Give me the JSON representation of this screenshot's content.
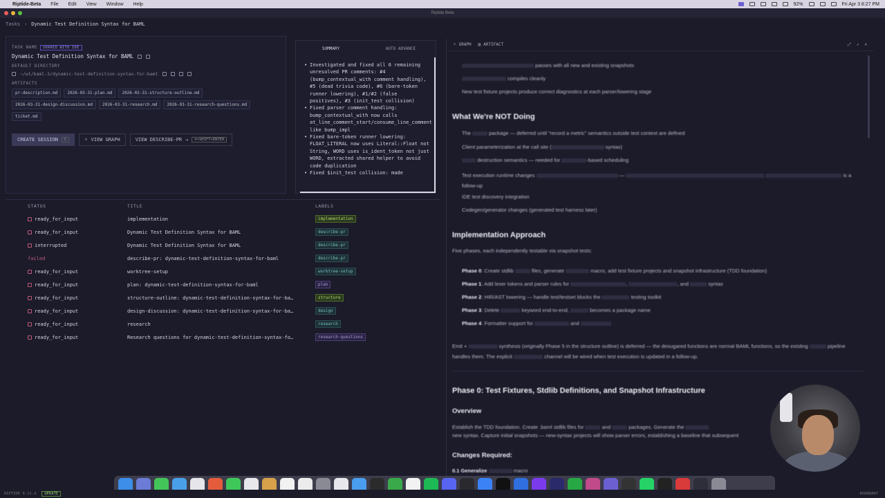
{
  "menubar": {
    "app": "Riptide-Beta",
    "items": [
      "File",
      "Edit",
      "View",
      "Window",
      "Help"
    ],
    "battery": "92%",
    "clock": "Fri Apr 3  8:27 PM"
  },
  "window": {
    "title": "Riptide Beta"
  },
  "breadcrumb": {
    "root": "Tasks",
    "current": "Dynamic Test Definition Syntax for BAML"
  },
  "session": {
    "task_name_label": "TASK NAME",
    "shared_badge": "SHARED WITH IDE",
    "task_name": "Dynamic Test Definition Syntax for BAML",
    "dir_label": "DEFAULT DIRECTORY",
    "dir": "~/wt/baml-3/dynamic-test-definition-syntax-for-baml",
    "artifacts_label": "ARTIFACTS",
    "artifacts": [
      "pr-description.md",
      "2026-03-31-plan.md",
      "2026-03-31-structure-outline.md",
      "2026-03-31-design-discussion.md",
      "2026-03-31-research.md",
      "2026-03-31-research-questions.md",
      "ticket.md"
    ],
    "create_session": "CREATE SESSION",
    "create_session_key": "C",
    "view_graph": "VIEW GRAPH",
    "view_describe": "VIEW DESCRIBE-PR",
    "view_describe_key": "⌘+SHIFT+ENTER"
  },
  "summary": {
    "tab_summary": "SUMMARY",
    "tab_auto": "AUTO ADVANCE",
    "bullets": [
      "Investigated and fixed all 6 remaining unresolved PR comments: #4 (bump_contextual_with comment handling), #5 (dead trivia code), #6 (bare-token runner lowering), #1/#2 (false positives), #3 (init_test collision)",
      "Fixed parser comment handling: bump_contextual_with now calls at_line_comment_start/consume_line_comment like bump_impl",
      "Fixed bare-token runner lowering: FLOAT_LITERAL now uses Literal::Float not String, WORD uses is_ident_token not just WORD, extracted shared helper to avoid code duplication",
      "Fixed $init_test collision: made"
    ]
  },
  "tasks": {
    "headers": {
      "status": "STATUS",
      "title": "TITLE",
      "labels": "LABELS"
    },
    "rows": [
      {
        "status": "ready_for_input",
        "title": "implementation",
        "label": "implementation"
      },
      {
        "status": "ready_for_input",
        "title": "Dynamic Test Definition Syntax for BAML",
        "label": "describe-pr"
      },
      {
        "status": "interrupted",
        "title": "Dynamic Test Definition Syntax for BAML",
        "label": "describe-pr"
      },
      {
        "status": "failed",
        "title": "describe-pr: dynamic-test-definition-syntax-for-baml",
        "label": "describe-pr"
      },
      {
        "status": "ready_for_input",
        "title": "worktree-setup",
        "label": "worktree-setup"
      },
      {
        "status": "ready_for_input",
        "title": "plan: dynamic-test-definition-syntax-for-baml",
        "label": "plan"
      },
      {
        "status": "ready_for_input",
        "title": "structure-outline: dynamic-test-definition-syntax-for-ba…",
        "label": "structure"
      },
      {
        "status": "ready_for_input",
        "title": "design-discussion: dynamic-test-definition-syntax-for-ba…",
        "label": "design"
      },
      {
        "status": "ready_for_input",
        "title": "research",
        "label": "research"
      },
      {
        "status": "ready_for_input",
        "title": "Research questions for dynamic-test-definition-syntax-fo…",
        "label": "research-questions"
      }
    ]
  },
  "artifact": {
    "tab_graph": "GRAPH",
    "tab_artifact": "ARTIFACT",
    "line1": "passes with all new and existing snapshots",
    "line2": "compiles cleanly",
    "line3": "New test fixture projects produce correct diagnostics at each parser/lowering stage",
    "h_not_doing": "What We're NOT Doing",
    "not1a": "The",
    "not1b": "package — deferred until \"record a metric\" semantics outside test context are defined",
    "not2": "Client parameterization at the call site (",
    "not2b": "syntax)",
    "not3": "destruction semantics — needed for",
    "not3b": "-based scheduling",
    "not4": "Test execution runtime changes",
    "not4b": "is a follow-up",
    "not5": "IDE test discovery integration",
    "not6": "Codegen/generator changes (generated test harness later)",
    "h_impl": "Implementation Approach",
    "impl_intro": "Five phases, each independently testable via snapshot tests:",
    "phase0_label": "Phase 0",
    "phase0": ": Create stdlib",
    "phase0b": "files, generate",
    "phase0c": "macro, add test fixture projects and snapshot infrastructure (TDD foundation)",
    "phase1_label": "Phase 1",
    "phase1": ": Add lexer tokens and parser rules for",
    "phase1b": ", and",
    "phase1c": "syntax",
    "phase2_label": "Phase 2",
    "phase2": ": HIR/AST lowering — handle test/testset blocks the",
    "phase2b": "testing toolkit",
    "phase3_label": "Phase 3",
    "phase3": ": Delete",
    "phase3b": "keyword end-to-end,",
    "phase3c": "becomes a package name",
    "phase4_label": "Phase 4",
    "phase4": ": Formatter support for",
    "phase4b": "and",
    "emit1": "Emit +",
    "emit1b": "synthesis (originally Phase 5 in the structure outline) is deferred — the desugared functions are normal BAML functions, so the existing",
    "emit2": "pipeline handles them. The explicit",
    "emit2b": "channel will be wired when test execution is updated in a follow-up.",
    "h_phase0": "Phase 0: Test Fixtures, Stdlib Definitions, and Snapshot Infrastructure",
    "h_overview": "Overview",
    "overview1": "Establish the TDD foundation. Create .baml stdlib files for",
    "overview1b": "and",
    "overview1c": "packages. Generate the",
    "overview2": "new syntax. Capture initial snapshots — new-syntax projects will show parser errors, establishing a baseline that subsequent",
    "h_changes": "Changes Required:",
    "change1": "0.1 Generalize",
    "change1b": "macro"
  },
  "statusbar": {
    "version": "RIPTIDE 0.11.4",
    "update": "UPDATE",
    "right": "BOUNDARY"
  },
  "colors": {
    "accent": "#6b5fd1",
    "failed": "#c05a7a",
    "label_teal": "#6fc0c6"
  }
}
